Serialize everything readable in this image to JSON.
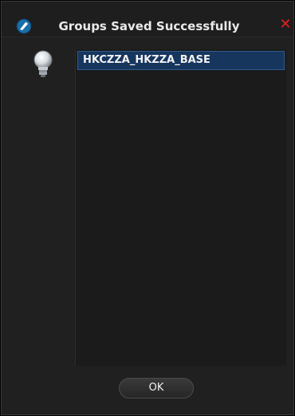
{
  "window": {
    "title": "Groups Saved Successfully",
    "close_glyph": "✕",
    "icon": "app-logo-icon",
    "info_icon": "lightbulb-icon"
  },
  "list": {
    "items": [
      {
        "label": "HKCZZA_HKZZA_BASE",
        "selected": true
      }
    ]
  },
  "buttons": {
    "ok_label": "OK"
  },
  "colors": {
    "background": "#202020",
    "selection": "#17365e",
    "close": "#e02020",
    "text": "#eaeaea"
  }
}
